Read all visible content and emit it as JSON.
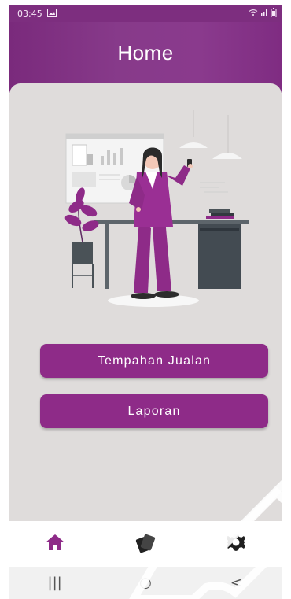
{
  "status_bar": {
    "time": "03:45",
    "image_icon": "image-icon",
    "wifi_icon": "wifi-icon",
    "signal_icon": "signal-icon",
    "battery_icon": "battery-icon"
  },
  "header": {
    "title": "Home"
  },
  "actions": [
    {
      "label": "Tempahan Jualan"
    },
    {
      "label": "Laporan"
    }
  ],
  "bottom_nav": {
    "home_icon": "home-icon",
    "cards_icon": "cards-icon",
    "settings_icon": "settings-icon"
  },
  "android_nav": {
    "recents": "|||",
    "home": "○",
    "back": "<"
  },
  "colors": {
    "primary": "#8e2b88",
    "header": "#7d2e7f",
    "content_background": "#dfdcdb",
    "nav_active": "#8e2b88"
  }
}
